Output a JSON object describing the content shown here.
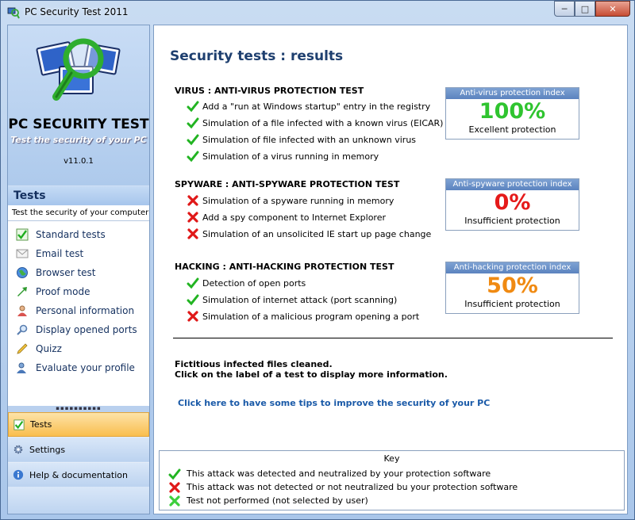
{
  "window": {
    "title": "PC Security Test 2011"
  },
  "sidebar": {
    "logo_title": "PC SECURITY TEST",
    "logo_subtitle": "Test the security of your PC",
    "version": "v11.0.1",
    "section_title": "Tests",
    "section_subtitle": "Test the security of your computer",
    "nav": [
      {
        "label": "Standard tests",
        "icon": "check-box-icon"
      },
      {
        "label": "Email test",
        "icon": "mail-icon"
      },
      {
        "label": "Browser test",
        "icon": "globe-icon"
      },
      {
        "label": "Proof mode",
        "icon": "arrow-icon"
      },
      {
        "label": "Personal information",
        "icon": "person-icon"
      },
      {
        "label": "Display opened ports",
        "icon": "magnifier-icon"
      },
      {
        "label": "Quizz",
        "icon": "pencil-icon"
      },
      {
        "label": "Evaluate your profile",
        "icon": "profile-icon"
      }
    ],
    "bottom": [
      {
        "label": "Tests",
        "icon": "check-box-icon"
      },
      {
        "label": "Settings",
        "icon": "gear-icon"
      },
      {
        "label": "Help & documentation",
        "icon": "info-icon"
      }
    ]
  },
  "main": {
    "title": "Security tests : results",
    "sections": [
      {
        "heading": "VIRUS : ANTI-VIRUS PROTECTION TEST",
        "tests": [
          {
            "label": "Add a \"run at Windows startup\" entry in the registry",
            "status": "pass"
          },
          {
            "label": "Simulation of a file infected with a known virus (EICAR)",
            "status": "pass"
          },
          {
            "label": "Simulation of file infected with an unknown virus",
            "status": "pass"
          },
          {
            "label": "Simulation of a virus running in memory",
            "status": "pass"
          }
        ],
        "index": {
          "title": "Anti-virus protection index",
          "value": "100%",
          "label": "Excellent protection",
          "color": "#2fc42f"
        }
      },
      {
        "heading": "SPYWARE : ANTI-SPYWARE PROTECTION TEST",
        "tests": [
          {
            "label": "Simulation of a spyware running in memory",
            "status": "fail"
          },
          {
            "label": "Add a spy component to Internet Explorer",
            "status": "fail"
          },
          {
            "label": "Simulation of an unsolicited IE start up page change",
            "status": "fail"
          }
        ],
        "index": {
          "title": "Anti-spyware protection index",
          "value": "0%",
          "label": "Insufficient protection",
          "color": "#e51a1a"
        }
      },
      {
        "heading": "HACKING : ANTI-HACKING PROTECTION TEST",
        "tests": [
          {
            "label": "Detection of open ports",
            "status": "pass"
          },
          {
            "label": "Simulation of internet attack (port scanning)",
            "status": "pass"
          },
          {
            "label": "Simulation of a malicious program opening a port",
            "status": "fail"
          }
        ],
        "index": {
          "title": "Anti-hacking protection index",
          "value": "50%",
          "label": "Insufficient protection",
          "color": "#f08a12"
        }
      }
    ],
    "note_line1": "Fictitious infected files cleaned.",
    "note_line2": "Click on the label of a test to display more information.",
    "tips_link": "Click here to have some tips to improve the security of your PC",
    "key": {
      "title": "Key",
      "rows": [
        {
          "label": "This attack was detected and neutralized by your protection software",
          "icon": "check-icon"
        },
        {
          "label": "This attack was not detected or not neutralized bu your protection software",
          "icon": "red-x-icon"
        },
        {
          "label": "Test not performed (not selected by user)",
          "icon": "green-x-icon"
        }
      ]
    }
  },
  "colors": {
    "pass": "#22b422",
    "fail": "#e01818",
    "not_run": "#3ccf3c",
    "link": "#1a5aa8",
    "title": "#1e3f6f"
  }
}
